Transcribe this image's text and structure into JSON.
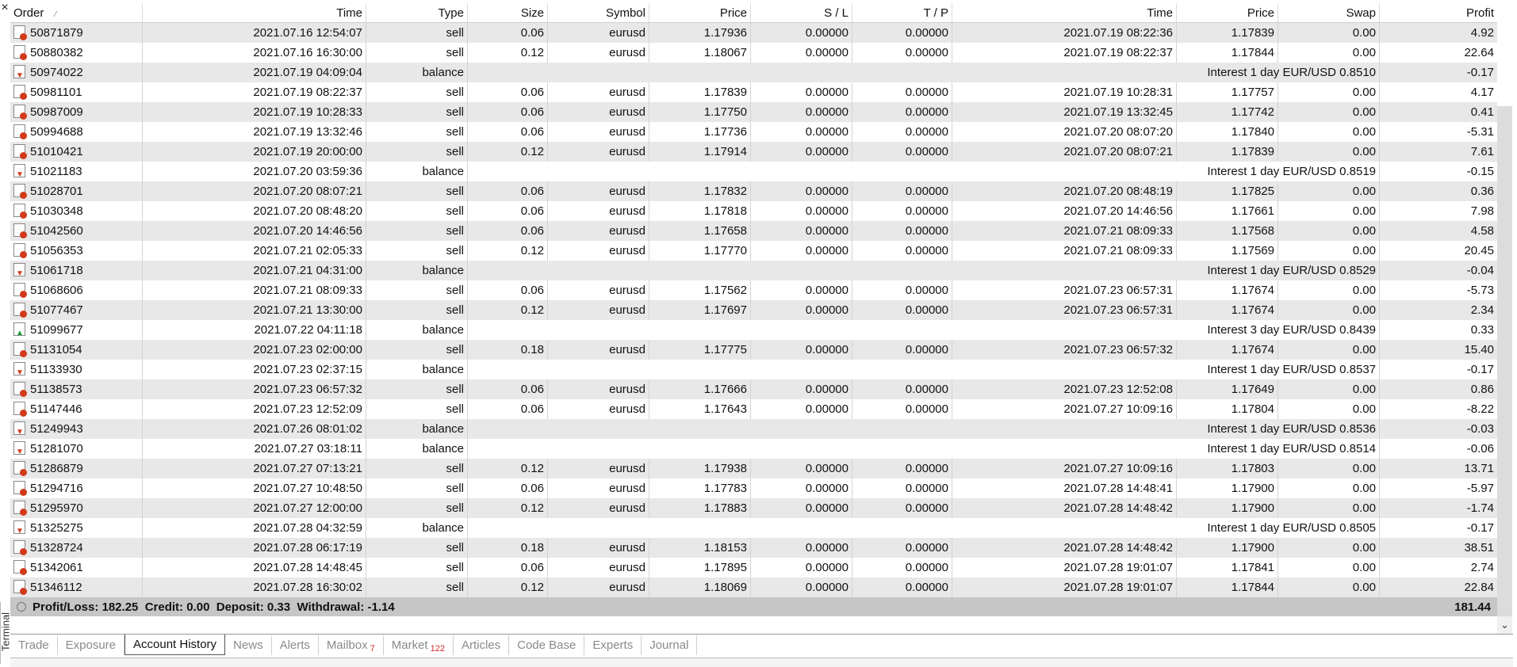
{
  "panel": {
    "close_label": "×",
    "side_label": "Terminal"
  },
  "columns": [
    "Order",
    "Time",
    "Type",
    "Size",
    "Symbol",
    "Price",
    "S / L",
    "T / P",
    "Time",
    "Price",
    "Swap",
    "Profit"
  ],
  "rows": [
    {
      "icon": "trade",
      "order": "50871879",
      "time": "2021.07.16 12:54:07",
      "type": "sell",
      "size": "0.06",
      "symbol": "eurusd",
      "price": "1.17936",
      "sl": "0.00000",
      "tp": "0.00000",
      "ctime": "2021.07.19 08:22:36",
      "cprice": "1.17839",
      "swap": "0.00",
      "profit": "4.92"
    },
    {
      "icon": "trade",
      "order": "50880382",
      "time": "2021.07.16 16:30:00",
      "type": "sell",
      "size": "0.12",
      "symbol": "eurusd",
      "price": "1.18067",
      "sl": "0.00000",
      "tp": "0.00000",
      "ctime": "2021.07.19 08:22:37",
      "cprice": "1.17844",
      "swap": "0.00",
      "profit": "22.64"
    },
    {
      "icon": "bal-down",
      "order": "50974022",
      "time": "2021.07.19 04:09:04",
      "type": "balance",
      "comment": "Interest 1 day EUR/USD 0.8510",
      "profit": "-0.17"
    },
    {
      "icon": "trade",
      "order": "50981101",
      "time": "2021.07.19 08:22:37",
      "type": "sell",
      "size": "0.06",
      "symbol": "eurusd",
      "price": "1.17839",
      "sl": "0.00000",
      "tp": "0.00000",
      "ctime": "2021.07.19 10:28:31",
      "cprice": "1.17757",
      "swap": "0.00",
      "profit": "4.17"
    },
    {
      "icon": "trade",
      "order": "50987009",
      "time": "2021.07.19 10:28:33",
      "type": "sell",
      "size": "0.06",
      "symbol": "eurusd",
      "price": "1.17750",
      "sl": "0.00000",
      "tp": "0.00000",
      "ctime": "2021.07.19 13:32:45",
      "cprice": "1.17742",
      "swap": "0.00",
      "profit": "0.41"
    },
    {
      "icon": "trade",
      "order": "50994688",
      "time": "2021.07.19 13:32:46",
      "type": "sell",
      "size": "0.06",
      "symbol": "eurusd",
      "price": "1.17736",
      "sl": "0.00000",
      "tp": "0.00000",
      "ctime": "2021.07.20 08:07:20",
      "cprice": "1.17840",
      "swap": "0.00",
      "profit": "-5.31"
    },
    {
      "icon": "trade",
      "order": "51010421",
      "time": "2021.07.19 20:00:00",
      "type": "sell",
      "size": "0.12",
      "symbol": "eurusd",
      "price": "1.17914",
      "sl": "0.00000",
      "tp": "0.00000",
      "ctime": "2021.07.20 08:07:21",
      "cprice": "1.17839",
      "swap": "0.00",
      "profit": "7.61"
    },
    {
      "icon": "bal-down",
      "order": "51021183",
      "time": "2021.07.20 03:59:36",
      "type": "balance",
      "comment": "Interest 1 day EUR/USD 0.8519",
      "profit": "-0.15"
    },
    {
      "icon": "trade",
      "order": "51028701",
      "time": "2021.07.20 08:07:21",
      "type": "sell",
      "size": "0.06",
      "symbol": "eurusd",
      "price": "1.17832",
      "sl": "0.00000",
      "tp": "0.00000",
      "ctime": "2021.07.20 08:48:19",
      "cprice": "1.17825",
      "swap": "0.00",
      "profit": "0.36"
    },
    {
      "icon": "trade",
      "order": "51030348",
      "time": "2021.07.20 08:48:20",
      "type": "sell",
      "size": "0.06",
      "symbol": "eurusd",
      "price": "1.17818",
      "sl": "0.00000",
      "tp": "0.00000",
      "ctime": "2021.07.20 14:46:56",
      "cprice": "1.17661",
      "swap": "0.00",
      "profit": "7.98"
    },
    {
      "icon": "trade",
      "order": "51042560",
      "time": "2021.07.20 14:46:56",
      "type": "sell",
      "size": "0.06",
      "symbol": "eurusd",
      "price": "1.17658",
      "sl": "0.00000",
      "tp": "0.00000",
      "ctime": "2021.07.21 08:09:33",
      "cprice": "1.17568",
      "swap": "0.00",
      "profit": "4.58"
    },
    {
      "icon": "trade",
      "order": "51056353",
      "time": "2021.07.21 02:05:33",
      "type": "sell",
      "size": "0.12",
      "symbol": "eurusd",
      "price": "1.17770",
      "sl": "0.00000",
      "tp": "0.00000",
      "ctime": "2021.07.21 08:09:33",
      "cprice": "1.17569",
      "swap": "0.00",
      "profit": "20.45"
    },
    {
      "icon": "bal-down",
      "order": "51061718",
      "time": "2021.07.21 04:31:00",
      "type": "balance",
      "comment": "Interest 1 day EUR/USD 0.8529",
      "profit": "-0.04"
    },
    {
      "icon": "trade",
      "order": "51068606",
      "time": "2021.07.21 08:09:33",
      "type": "sell",
      "size": "0.06",
      "symbol": "eurusd",
      "price": "1.17562",
      "sl": "0.00000",
      "tp": "0.00000",
      "ctime": "2021.07.23 06:57:31",
      "cprice": "1.17674",
      "swap": "0.00",
      "profit": "-5.73"
    },
    {
      "icon": "trade",
      "order": "51077467",
      "time": "2021.07.21 13:30:00",
      "type": "sell",
      "size": "0.12",
      "symbol": "eurusd",
      "price": "1.17697",
      "sl": "0.00000",
      "tp": "0.00000",
      "ctime": "2021.07.23 06:57:31",
      "cprice": "1.17674",
      "swap": "0.00",
      "profit": "2.34"
    },
    {
      "icon": "bal-up",
      "order": "51099677",
      "time": "2021.07.22 04:11:18",
      "type": "balance",
      "comment": "Interest 3 day EUR/USD 0.8439",
      "profit": "0.33"
    },
    {
      "icon": "trade",
      "order": "51131054",
      "time": "2021.07.23 02:00:00",
      "type": "sell",
      "size": "0.18",
      "symbol": "eurusd",
      "price": "1.17775",
      "sl": "0.00000",
      "tp": "0.00000",
      "ctime": "2021.07.23 06:57:32",
      "cprice": "1.17674",
      "swap": "0.00",
      "profit": "15.40"
    },
    {
      "icon": "bal-down",
      "order": "51133930",
      "time": "2021.07.23 02:37:15",
      "type": "balance",
      "comment": "Interest 1 day EUR/USD 0.8537",
      "profit": "-0.17"
    },
    {
      "icon": "trade",
      "order": "51138573",
      "time": "2021.07.23 06:57:32",
      "type": "sell",
      "size": "0.06",
      "symbol": "eurusd",
      "price": "1.17666",
      "sl": "0.00000",
      "tp": "0.00000",
      "ctime": "2021.07.23 12:52:08",
      "cprice": "1.17649",
      "swap": "0.00",
      "profit": "0.86"
    },
    {
      "icon": "trade",
      "order": "51147446",
      "time": "2021.07.23 12:52:09",
      "type": "sell",
      "size": "0.06",
      "symbol": "eurusd",
      "price": "1.17643",
      "sl": "0.00000",
      "tp": "0.00000",
      "ctime": "2021.07.27 10:09:16",
      "cprice": "1.17804",
      "swap": "0.00",
      "profit": "-8.22"
    },
    {
      "icon": "bal-down",
      "order": "51249943",
      "time": "2021.07.26 08:01:02",
      "type": "balance",
      "comment": "Interest 1 day EUR/USD 0.8536",
      "profit": "-0.03"
    },
    {
      "icon": "bal-down",
      "order": "51281070",
      "time": "2021.07.27 03:18:11",
      "type": "balance",
      "comment": "Interest 1 day EUR/USD 0.8514",
      "profit": "-0.06"
    },
    {
      "icon": "trade",
      "order": "51286879",
      "time": "2021.07.27 07:13:21",
      "type": "sell",
      "size": "0.12",
      "symbol": "eurusd",
      "price": "1.17938",
      "sl": "0.00000",
      "tp": "0.00000",
      "ctime": "2021.07.27 10:09:16",
      "cprice": "1.17803",
      "swap": "0.00",
      "profit": "13.71"
    },
    {
      "icon": "trade",
      "order": "51294716",
      "time": "2021.07.27 10:48:50",
      "type": "sell",
      "size": "0.06",
      "symbol": "eurusd",
      "price": "1.17783",
      "sl": "0.00000",
      "tp": "0.00000",
      "ctime": "2021.07.28 14:48:41",
      "cprice": "1.17900",
      "swap": "0.00",
      "profit": "-5.97"
    },
    {
      "icon": "trade",
      "order": "51295970",
      "time": "2021.07.27 12:00:00",
      "type": "sell",
      "size": "0.12",
      "symbol": "eurusd",
      "price": "1.17883",
      "sl": "0.00000",
      "tp": "0.00000",
      "ctime": "2021.07.28 14:48:42",
      "cprice": "1.17900",
      "swap": "0.00",
      "profit": "-1.74"
    },
    {
      "icon": "bal-down",
      "order": "51325275",
      "time": "2021.07.28 04:32:59",
      "type": "balance",
      "comment": "Interest 1 day EUR/USD 0.8505",
      "profit": "-0.17"
    },
    {
      "icon": "trade",
      "order": "51328724",
      "time": "2021.07.28 06:17:19",
      "type": "sell",
      "size": "0.18",
      "symbol": "eurusd",
      "price": "1.18153",
      "sl": "0.00000",
      "tp": "0.00000",
      "ctime": "2021.07.28 14:48:42",
      "cprice": "1.17900",
      "swap": "0.00",
      "profit": "38.51"
    },
    {
      "icon": "trade",
      "order": "51342061",
      "time": "2021.07.28 14:48:45",
      "type": "sell",
      "size": "0.06",
      "symbol": "eurusd",
      "price": "1.17895",
      "sl": "0.00000",
      "tp": "0.00000",
      "ctime": "2021.07.28 19:01:07",
      "cprice": "1.17841",
      "swap": "0.00",
      "profit": "2.74"
    },
    {
      "icon": "trade",
      "order": "51346112",
      "time": "2021.07.28 16:30:02",
      "type": "sell",
      "size": "0.12",
      "symbol": "eurusd",
      "price": "1.18069",
      "sl": "0.00000",
      "tp": "0.00000",
      "ctime": "2021.07.28 19:01:07",
      "cprice": "1.17844",
      "swap": "0.00",
      "profit": "22.84"
    }
  ],
  "summary": {
    "text": "Profit/Loss: 182.25  Credit: 0.00  Deposit: 0.33  Withdrawal: -1.14",
    "total": "181.44"
  },
  "tabs": [
    {
      "label": "Trade",
      "active": false,
      "badge": ""
    },
    {
      "label": "Exposure",
      "active": false,
      "badge": ""
    },
    {
      "label": "Account History",
      "active": true,
      "badge": ""
    },
    {
      "label": "News",
      "active": false,
      "badge": ""
    },
    {
      "label": "Alerts",
      "active": false,
      "badge": ""
    },
    {
      "label": "Mailbox",
      "active": false,
      "badge": "7"
    },
    {
      "label": "Market",
      "active": false,
      "badge": "122"
    },
    {
      "label": "Articles",
      "active": false,
      "badge": ""
    },
    {
      "label": "Code Base",
      "active": false,
      "badge": ""
    },
    {
      "label": "Experts",
      "active": false,
      "badge": ""
    },
    {
      "label": "Journal",
      "active": false,
      "badge": ""
    }
  ],
  "icons": {
    "sort": "sort-icon",
    "scroll_down": "chevron-down-icon"
  }
}
